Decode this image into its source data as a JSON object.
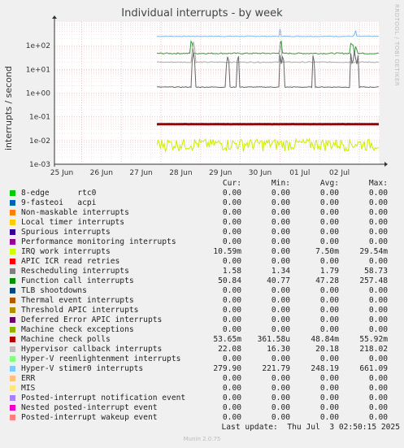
{
  "title": "Individual interrupts - by week",
  "watermark": "RRDTOOL / TOBI OETIKER",
  "footer": "Munin 2.0.75",
  "last_update": "Last update:  Thu Jul  3 02:50:15 2025",
  "legend_headers": [
    "Cur:",
    "Min:",
    "Avg:",
    "Max:"
  ],
  "chart_data": {
    "type": "line",
    "title": "Individual interrupts - by week",
    "ylabel": "interrupts / second",
    "yscale": "log",
    "ylim": [
      0.001,
      1000
    ],
    "yticks": [
      "1e+02",
      "1e+01",
      "1e+00",
      "1e-01",
      "1e-02",
      "1e-03"
    ],
    "xticks": [
      "25 Jun",
      "26 Jun",
      "27 Jun",
      "28 Jun",
      "29 Jun",
      "30 Jun",
      "01 Jul",
      "02 Jul"
    ],
    "grid": true,
    "series": [
      {
        "name": "Hyper-V stimer0 interrupts",
        "color": "#7fb8e8",
        "base": 248.19,
        "min": 221.79,
        "max": 661.09
      },
      {
        "name": "Function call interrupts",
        "color": "#3a9a3a",
        "base": 47.28,
        "min": 40.77,
        "max": 257.48
      },
      {
        "name": "Hypervisor callback interrupts",
        "color": "#aaaaaa",
        "base": 20.18,
        "min": 16.3,
        "max": 218.02
      },
      {
        "name": "Rescheduling interrupts",
        "color": "#666666",
        "base": 1.79,
        "min": 1.34,
        "max": 58.73
      },
      {
        "name": "Machine check polls",
        "color": "#9a0000",
        "base": 0.04884,
        "min": 0.00036158,
        "max": 0.05592
      },
      {
        "name": "IRQ work interrupts",
        "color": "#ccee00",
        "base": 0.0075,
        "min": 0.0,
        "max": 0.02954
      }
    ]
  },
  "legend_rows": [
    {
      "color": "#00cc00",
      "label": "8-edge      rtc0",
      "cur": "0.00",
      "min": "0.00",
      "avg": "0.00",
      "max": "0.00"
    },
    {
      "color": "#0066b3",
      "label": "9-fasteoi   acpi",
      "cur": "0.00",
      "min": "0.00",
      "avg": "0.00",
      "max": "0.00"
    },
    {
      "color": "#ff8000",
      "label": "Non-maskable interrupts",
      "cur": "0.00",
      "min": "0.00",
      "avg": "0.00",
      "max": "0.00"
    },
    {
      "color": "#ffcc00",
      "label": "Local timer interrupts",
      "cur": "0.00",
      "min": "0.00",
      "avg": "0.00",
      "max": "0.00"
    },
    {
      "color": "#330099",
      "label": "Spurious interrupts",
      "cur": "0.00",
      "min": "0.00",
      "avg": "0.00",
      "max": "0.00"
    },
    {
      "color": "#990099",
      "label": "Performance monitoring interrupts",
      "cur": "0.00",
      "min": "0.00",
      "avg": "0.00",
      "max": "0.00"
    },
    {
      "color": "#ccff00",
      "label": "IRQ work interrupts",
      "cur": "10.59m",
      "min": "0.00",
      "avg": "7.50m",
      "max": "29.54m"
    },
    {
      "color": "#ff0000",
      "label": "APIC ICR read retries",
      "cur": "0.00",
      "min": "0.00",
      "avg": "0.00",
      "max": "0.00"
    },
    {
      "color": "#808080",
      "label": "Rescheduling interrupts",
      "cur": "1.58",
      "min": "1.34",
      "avg": "1.79",
      "max": "58.73"
    },
    {
      "color": "#008f00",
      "label": "Function call interrupts",
      "cur": "50.84",
      "min": "40.77",
      "avg": "47.28",
      "max": "257.48"
    },
    {
      "color": "#00487d",
      "label": "TLB shootdowns",
      "cur": "0.00",
      "min": "0.00",
      "avg": "0.00",
      "max": "0.00"
    },
    {
      "color": "#b35a00",
      "label": "Thermal event interrupts",
      "cur": "0.00",
      "min": "0.00",
      "avg": "0.00",
      "max": "0.00"
    },
    {
      "color": "#b38f00",
      "label": "Threshold APIC interrupts",
      "cur": "0.00",
      "min": "0.00",
      "avg": "0.00",
      "max": "0.00"
    },
    {
      "color": "#6b006b",
      "label": "Deferred Error APIC interrupts",
      "cur": "0.00",
      "min": "0.00",
      "avg": "0.00",
      "max": "0.00"
    },
    {
      "color": "#8fb300",
      "label": "Machine check exceptions",
      "cur": "0.00",
      "min": "0.00",
      "avg": "0.00",
      "max": "0.00"
    },
    {
      "color": "#b30000",
      "label": "Machine check polls",
      "cur": "53.65m",
      "min": "361.58u",
      "avg": "48.84m",
      "max": "55.92m"
    },
    {
      "color": "#bebebe",
      "label": "Hypervisor callback interrupts",
      "cur": "22.08",
      "min": "16.30",
      "avg": "20.18",
      "max": "218.02"
    },
    {
      "color": "#80ff80",
      "label": "Hyper-V reenlightenment interrupts",
      "cur": "0.00",
      "min": "0.00",
      "avg": "0.00",
      "max": "0.00"
    },
    {
      "color": "#80c9ff",
      "label": "Hyper-V stimer0 interrupts",
      "cur": "279.90",
      "min": "221.79",
      "avg": "248.19",
      "max": "661.09"
    },
    {
      "color": "#ffc080",
      "label": "ERR",
      "cur": "0.00",
      "min": "0.00",
      "avg": "0.00",
      "max": "0.00"
    },
    {
      "color": "#ffe680",
      "label": "MIS",
      "cur": "0.00",
      "min": "0.00",
      "avg": "0.00",
      "max": "0.00"
    },
    {
      "color": "#aa80ff",
      "label": "Posted-interrupt notification event",
      "cur": "0.00",
      "min": "0.00",
      "avg": "0.00",
      "max": "0.00"
    },
    {
      "color": "#ee00cc",
      "label": "Nested posted-interrupt event",
      "cur": "0.00",
      "min": "0.00",
      "avg": "0.00",
      "max": "0.00"
    },
    {
      "color": "#ff8080",
      "label": "Posted-interrupt wakeup event",
      "cur": "0.00",
      "min": "0.00",
      "avg": "0.00",
      "max": "0.00"
    }
  ]
}
